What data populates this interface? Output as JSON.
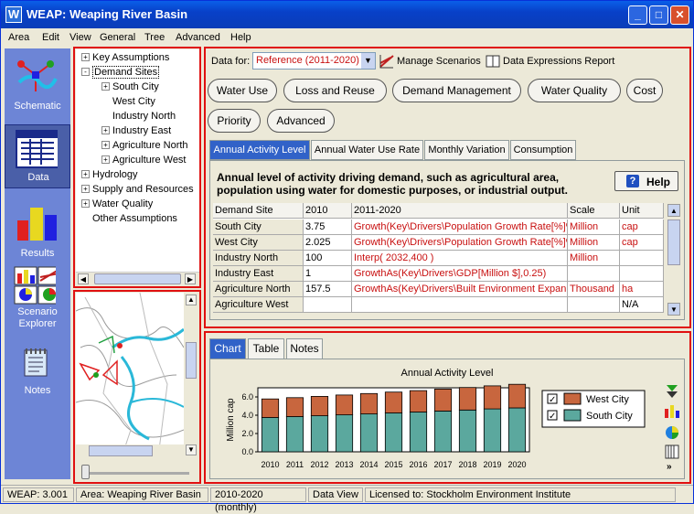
{
  "window": {
    "title": "WEAP: Weaping River Basin",
    "icon": "W"
  },
  "menu": [
    "Area",
    "Edit",
    "View",
    "General",
    "Tree",
    "Advanced",
    "Help"
  ],
  "sidebar": [
    {
      "label": "Schematic"
    },
    {
      "label": "Data"
    },
    {
      "label": "Results"
    },
    {
      "label": "Scenario Explorer"
    },
    {
      "label": "Notes"
    }
  ],
  "tree": [
    {
      "label": "Key Assumptions",
      "level": 0,
      "toggle": "+"
    },
    {
      "label": "Demand Sites",
      "level": 0,
      "toggle": "-"
    },
    {
      "label": "South City",
      "level": 1,
      "toggle": "+"
    },
    {
      "label": "West City",
      "level": 1,
      "toggle": ""
    },
    {
      "label": "Industry North",
      "level": 1,
      "toggle": ""
    },
    {
      "label": "Industry East",
      "level": 1,
      "toggle": "+"
    },
    {
      "label": "Agriculture North",
      "level": 1,
      "toggle": "+"
    },
    {
      "label": "Agriculture West",
      "level": 1,
      "toggle": "+"
    },
    {
      "label": "Hydrology",
      "level": 0,
      "toggle": "+"
    },
    {
      "label": "Supply and Resources",
      "level": 0,
      "toggle": "+"
    },
    {
      "label": "Water Quality",
      "level": 0,
      "toggle": "+"
    },
    {
      "label": "Other Assumptions",
      "level": 0,
      "toggle": ""
    }
  ],
  "data_for": {
    "label": "Data for:",
    "value": "Reference (2011-2020)"
  },
  "manage_scenarios": "Manage Scenarios",
  "data_expressions": "Data Expressions Report",
  "category_buttons": [
    "Water Use",
    "Loss and Reuse",
    "Demand Management",
    "Water Quality",
    "Cost",
    "Priority",
    "Advanced"
  ],
  "data_tabs": [
    "Annual Activity Level",
    "Annual Water Use Rate",
    "Monthly Variation",
    "Consumption"
  ],
  "description": "Annual level of activity driving demand, such as agricultural area, population using water for domestic purposes, or industrial output.",
  "help": "Help",
  "table": {
    "headers": [
      "Demand Site",
      "2010",
      "2011-2020",
      "Scale",
      "Unit"
    ],
    "rows": [
      [
        "South City",
        "3.75",
        "Growth(Key\\Drivers\\Population Growth Rate[%]%)",
        "Million",
        "cap"
      ],
      [
        "West City",
        "2.025",
        "Growth(Key\\Drivers\\Population Growth Rate[%]%)",
        "Million",
        "cap"
      ],
      [
        "Industry North",
        "100",
        "Interp( 2032,400 )",
        "Million",
        ""
      ],
      [
        "Industry East",
        "1",
        "GrowthAs(Key\\Drivers\\GDP[Million $],0.25)",
        "",
        ""
      ],
      [
        "Agriculture North",
        "157.5",
        "GrowthAs(Key\\Drivers\\Built Environment Expan...",
        "Thousand",
        "ha"
      ],
      [
        "Agriculture West",
        "",
        "",
        "",
        "N/A"
      ]
    ]
  },
  "result_tabs": [
    "Chart",
    "Table",
    "Notes"
  ],
  "chart_data": {
    "type": "bar",
    "stacked": true,
    "title": "Annual Activity Level",
    "ylabel": "Million cap",
    "xlabel": "",
    "categories": [
      "2010",
      "2011",
      "2012",
      "2013",
      "2014",
      "2015",
      "2016",
      "2017",
      "2018",
      "2019",
      "2020"
    ],
    "ylim": [
      0,
      7
    ],
    "yticks": [
      "0.0",
      "2.0",
      "4.0",
      "6.0"
    ],
    "series": [
      {
        "name": "South City",
        "color": "#5ba89e",
        "values": [
          3.75,
          3.85,
          3.94,
          4.04,
          4.14,
          4.25,
          4.35,
          4.46,
          4.57,
          4.69,
          4.8
        ]
      },
      {
        "name": "West City",
        "color": "#c8663e",
        "values": [
          2.03,
          2.07,
          2.12,
          2.17,
          2.23,
          2.28,
          2.34,
          2.4,
          2.46,
          2.52,
          2.58
        ]
      }
    ],
    "legend": "right"
  },
  "status": [
    "WEAP: 3.001",
    "Area: Weaping River Basin",
    "2010-2020 (monthly)",
    "Data View",
    "Licensed to: Stockholm Environment Institute"
  ]
}
